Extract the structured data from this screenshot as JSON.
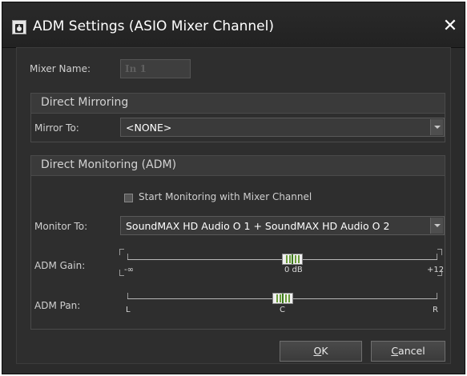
{
  "window": {
    "title": "ADM Settings (ASIO Mixer Channel)",
    "close_glyph": "✕"
  },
  "mixer_name": {
    "label": "Mixer Name:",
    "value": "In 1"
  },
  "direct_mirroring": {
    "header": "Direct Mirroring",
    "mirror_to_label": "Mirror To:",
    "mirror_to_value": "<NONE>"
  },
  "direct_monitoring": {
    "header": "Direct Monitoring (ADM)",
    "start_monitoring_label": "Start Monitoring with Mixer Channel",
    "start_monitoring_checked": false,
    "monitor_to_label": "Monitor To:",
    "monitor_to_value": "SoundMAX HD Audio O 1 + SoundMAX HD Audio O 2",
    "gain": {
      "label": "ADM Gain:",
      "min_label": "-∞",
      "center_label": "0 dB",
      "max_label": "+12",
      "value_db": 0
    },
    "pan": {
      "label": "ADM Pan:",
      "left_label": "L",
      "center_label": "C",
      "right_label": "R",
      "value": 0
    }
  },
  "buttons": {
    "ok_first": "O",
    "ok_rest": "K",
    "cancel_first": "C",
    "cancel_rest": "ancel"
  },
  "icons": {
    "title_icon": "speaker-icon",
    "close_icon": "close-icon",
    "combo_arrow": "chevron-down-icon"
  },
  "colors": {
    "dialog_bg": "#2b2b2b",
    "text": "#cfcfcf",
    "slider_thumb_mark": "#6a9a3a"
  }
}
